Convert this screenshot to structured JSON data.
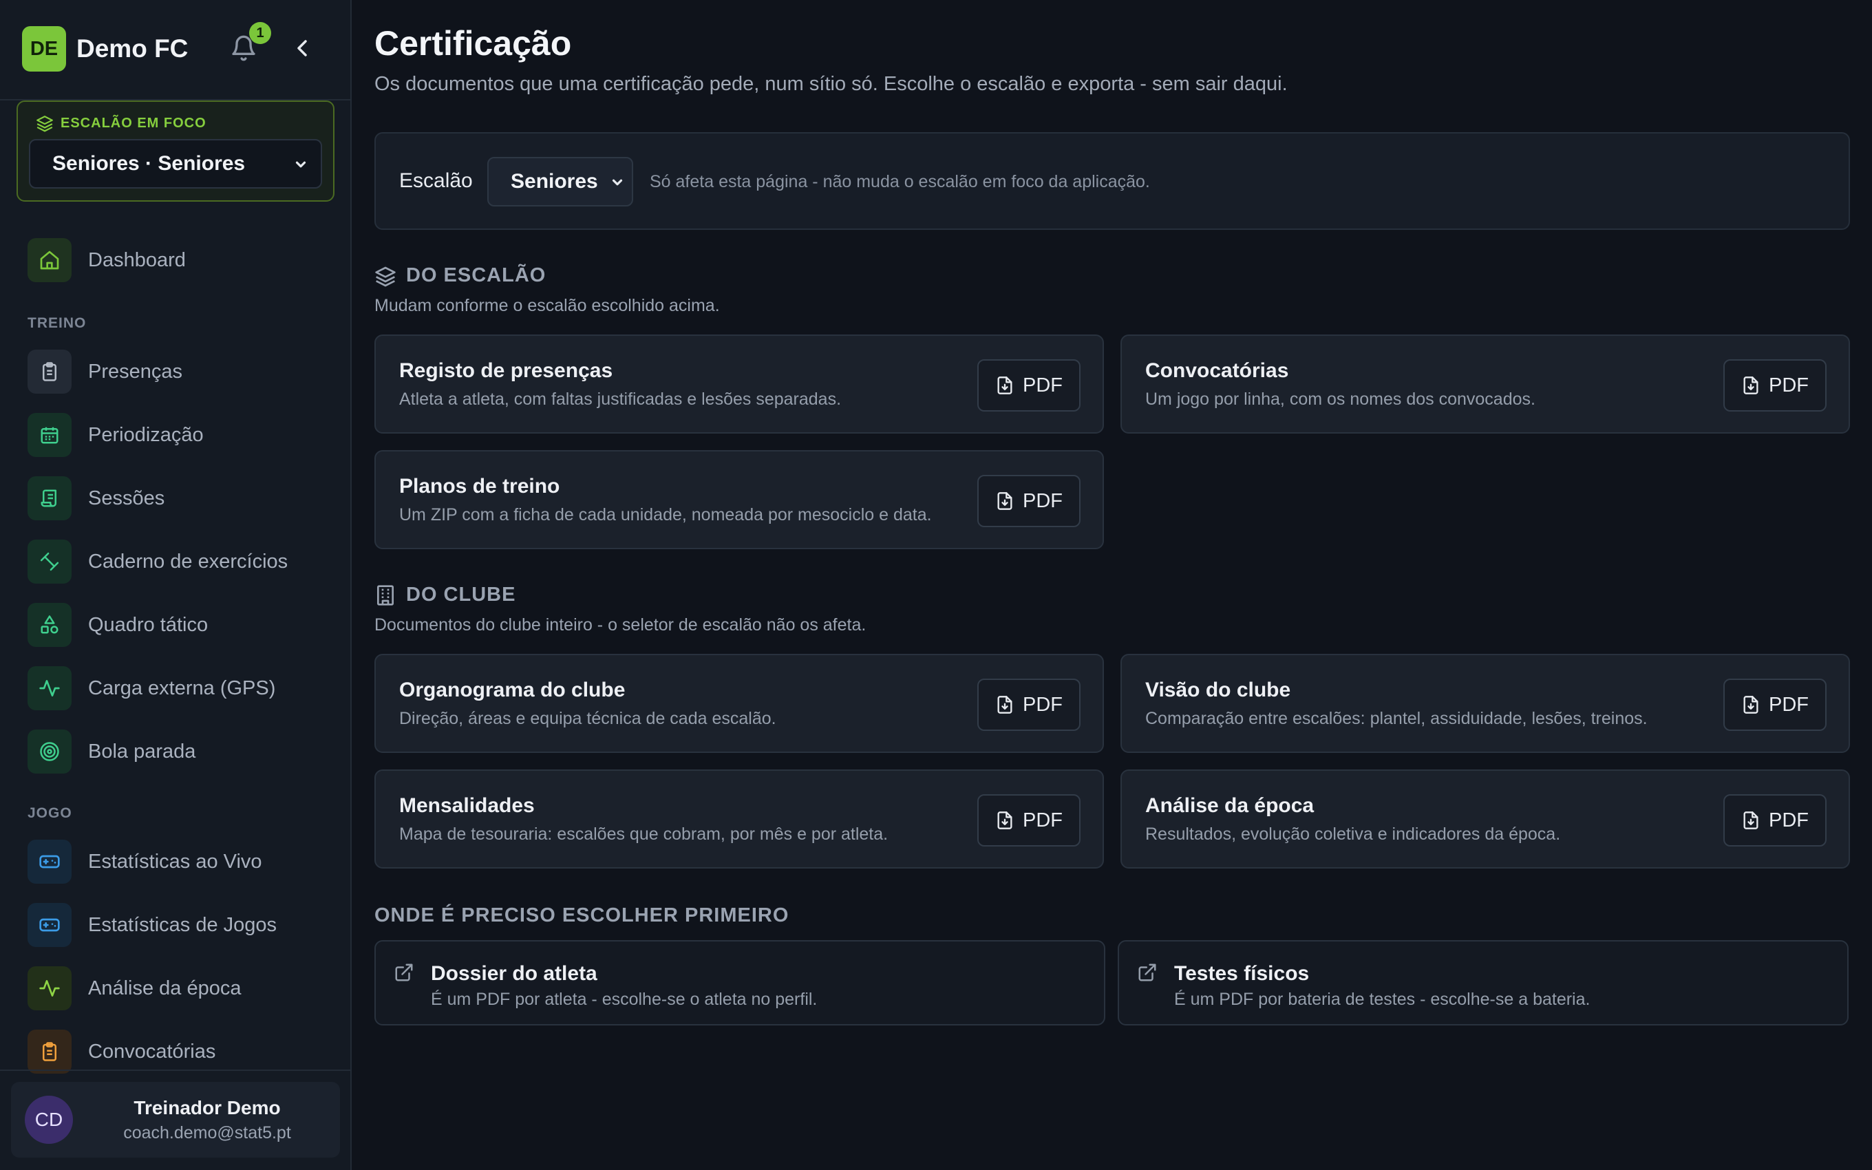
{
  "brand": {
    "initials": "DE",
    "name": "Demo FC",
    "notifications": "1"
  },
  "focus": {
    "label": "ESCALÃO EM FOCO",
    "selected": "Seniores · Seniores"
  },
  "nav": {
    "dashboard": "Dashboard",
    "section_treino": "TREINO",
    "treino": [
      {
        "label": "Presenças",
        "icon": "clipboard-icon"
      },
      {
        "label": "Periodização",
        "icon": "calendar-icon"
      },
      {
        "label": "Sessões",
        "icon": "scroll-icon"
      },
      {
        "label": "Caderno de exercícios",
        "icon": "dumbbell-icon"
      },
      {
        "label": "Quadro tático",
        "icon": "shapes-icon"
      },
      {
        "label": "Carga externa (GPS)",
        "icon": "activity-icon"
      },
      {
        "label": "Bola parada",
        "icon": "target-icon"
      }
    ],
    "section_jogo": "JOGO",
    "jogo": [
      {
        "label": "Estatísticas ao Vivo",
        "icon": "gamepad-icon"
      },
      {
        "label": "Estatísticas de Jogos",
        "icon": "gamepad-icon"
      },
      {
        "label": "Análise da época",
        "icon": "activity-icon"
      },
      {
        "label": "Convocatórias",
        "icon": "clipboard-list-icon"
      }
    ]
  },
  "user": {
    "initials": "CD",
    "name": "Treinador Demo",
    "email": "coach.demo@stat5.pt"
  },
  "page": {
    "title": "Certificação",
    "subtitle": "Os documentos que uma certificação pede, num sítio só. Escolhe o escalão e exporta - sem sair daqui."
  },
  "filter": {
    "label": "Escalão",
    "selected": "Seniores",
    "hint": "Só afeta esta página - não muda o escalão em foco da aplicação."
  },
  "section_escalao": {
    "title": "DO ESCALÃO",
    "subtitle": "Mudam conforme o escalão escolhido acima.",
    "docs": [
      {
        "title": "Registo de presenças",
        "desc": "Atleta a atleta, com faltas justificadas e lesões separadas.",
        "button": "PDF"
      },
      {
        "title": "Convocatórias",
        "desc": "Um jogo por linha, com os nomes dos convocados.",
        "button": "PDF"
      },
      {
        "title": "Planos de treino",
        "desc": "Um ZIP com a ficha de cada unidade, nomeada por mesociclo e data.",
        "button": "PDF"
      }
    ]
  },
  "section_clube": {
    "title": "DO CLUBE",
    "subtitle": "Documentos do clube inteiro - o seletor de escalão não os afeta.",
    "docs": [
      {
        "title": "Organograma do clube",
        "desc": "Direção, áreas e equipa técnica de cada escalão.",
        "button": "PDF"
      },
      {
        "title": "Visão do clube",
        "desc": "Comparação entre escalões: plantel, assiduidade, lesões, treinos.",
        "button": "PDF"
      },
      {
        "title": "Mensalidades",
        "desc": "Mapa de tesouraria: escalões que cobram, por mês e por atleta.",
        "button": "PDF"
      },
      {
        "title": "Análise da época",
        "desc": "Resultados, evolução coletiva e indicadores da época.",
        "button": "PDF"
      }
    ]
  },
  "section_first": {
    "title": "ONDE É PRECISO ESCOLHER PRIMEIRO",
    "links": [
      {
        "title": "Dossier do atleta",
        "desc": "É um PDF por atleta - escolhe-se o atleta no perfil."
      },
      {
        "title": "Testes físicos",
        "desc": "É um PDF por bateria de testes - escolhe-se a bateria."
      }
    ]
  },
  "colors": {
    "accent": "#7bc63a",
    "background": "#0f131b",
    "sidebar": "#141a23",
    "card": "#1b212b"
  }
}
